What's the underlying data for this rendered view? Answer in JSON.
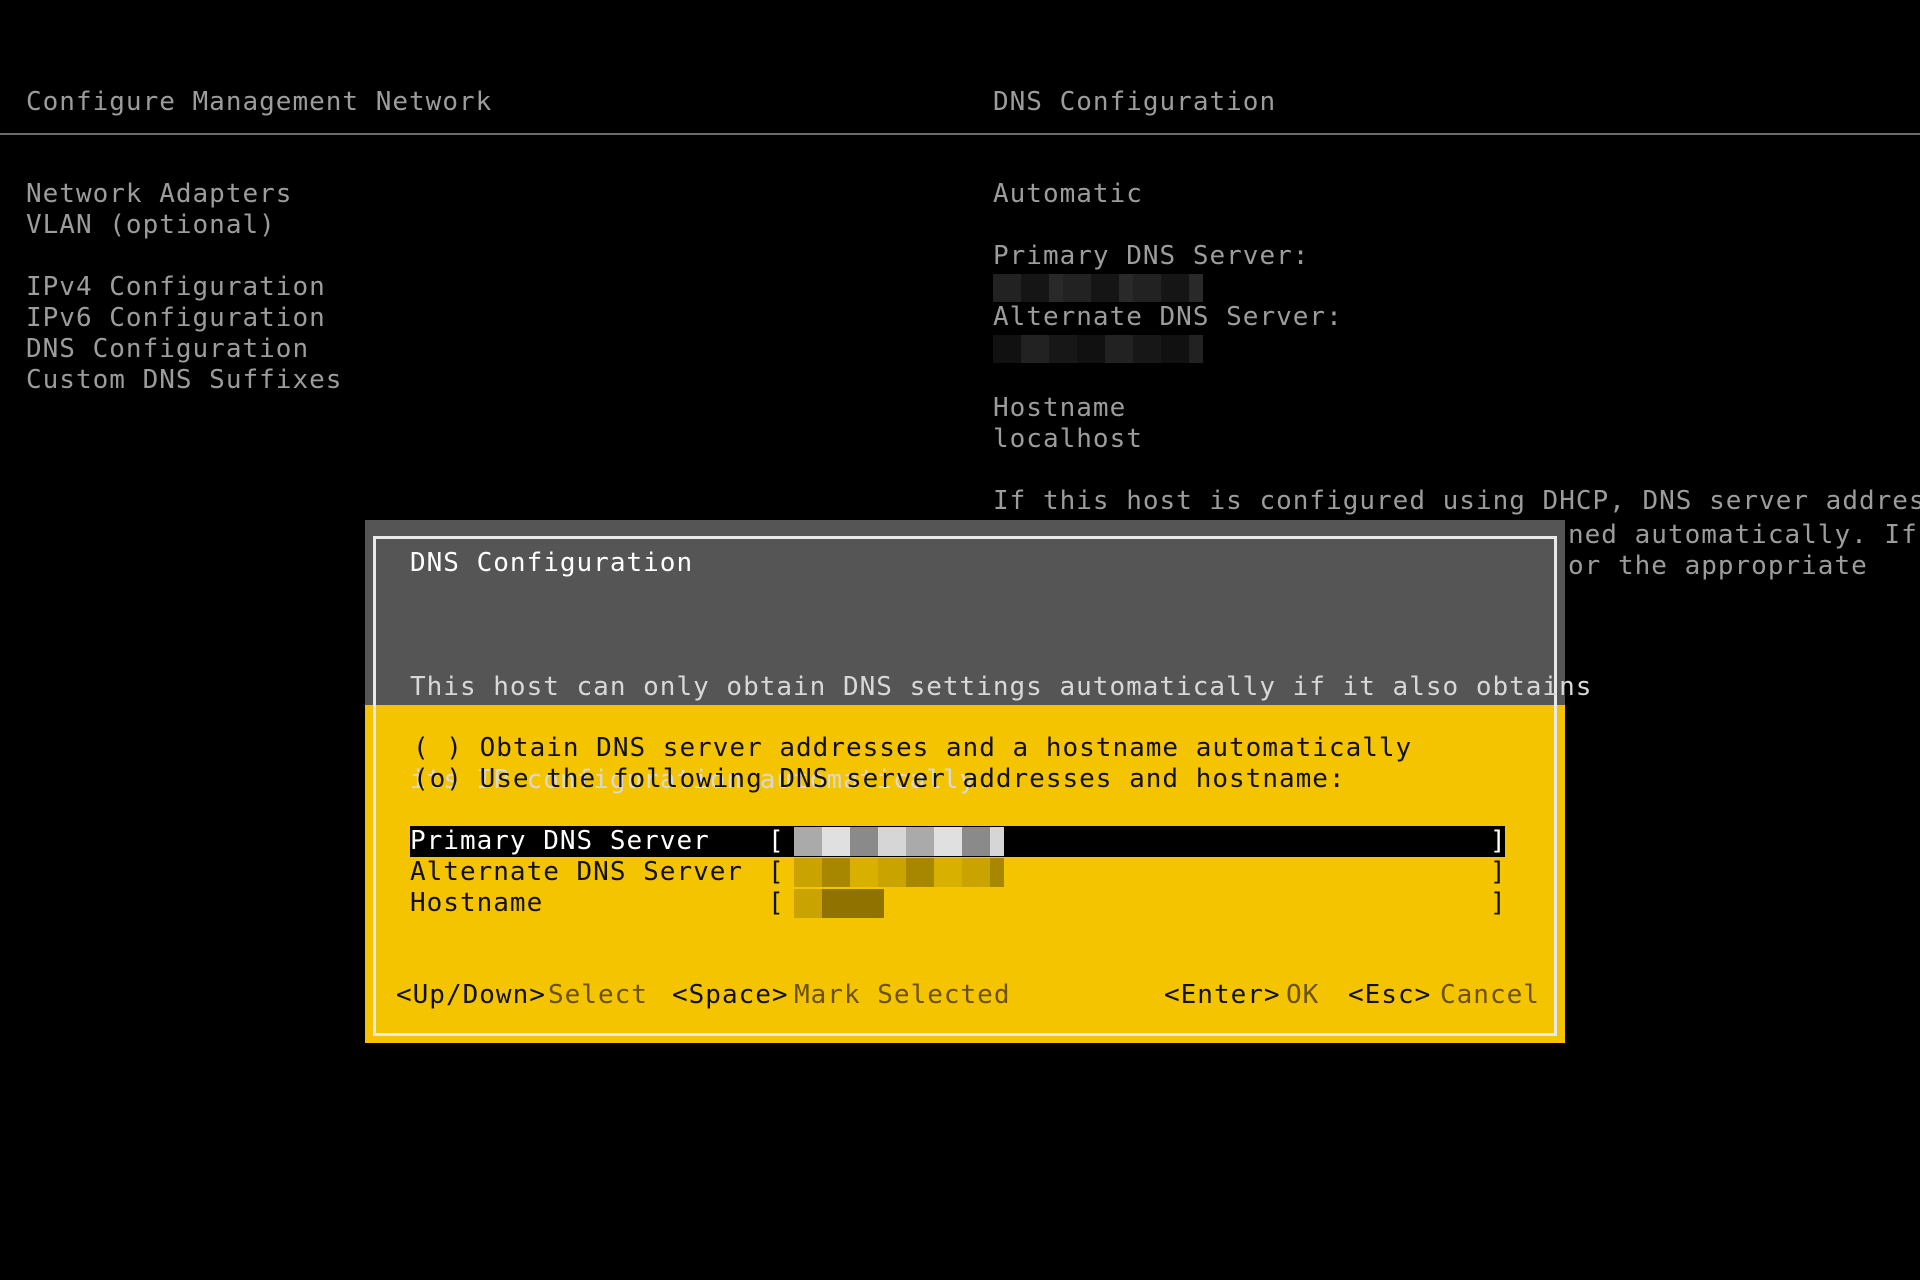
{
  "header": {
    "left_title": "Configure Management Network",
    "right_title": "DNS Configuration"
  },
  "menu": {
    "items": [
      "Network Adapters",
      "VLAN (optional)",
      "IPv4 Configuration",
      "IPv6 Configuration",
      "DNS Configuration",
      "Custom DNS Suffixes"
    ]
  },
  "info": {
    "mode": "Automatic",
    "primary_label": "Primary DNS Server:",
    "alternate_label": "Alternate DNS Server:",
    "hostname_label": "Hostname",
    "hostname_value": "localhost",
    "note_line1": "If this host is configured using DHCP, DNS server addresses",
    "note_line2": "ned automatically. If",
    "note_line3": "or the appropriate"
  },
  "dialog": {
    "title": "DNS Configuration",
    "desc_line1": "This host can only obtain DNS settings automatically if it also obtains",
    "desc_line2": "its IP configuration automatically.",
    "option_auto": "( ) Obtain DNS server addresses and a hostname automatically",
    "option_manual": "(o) Use the following DNS server addresses and hostname:",
    "fields": {
      "primary_label": "Primary DNS Server",
      "alternate_label": "Alternate DNS Server",
      "hostname_label": "Hostname",
      "open_bracket": "[",
      "close_bracket": "]"
    },
    "footer": {
      "updown_key": "<Up/Down>",
      "updown_action": "Select",
      "space_key": "<Space>",
      "space_action": "Mark Selected",
      "enter_key": "<Enter>",
      "enter_action": "OK",
      "esc_key": "<Esc>",
      "esc_action": "Cancel"
    }
  },
  "colors": {
    "background": "#000000",
    "dialog_accent": "#f5c400",
    "dialog_header": "#555555",
    "dim_text": "#9c9c9c"
  }
}
